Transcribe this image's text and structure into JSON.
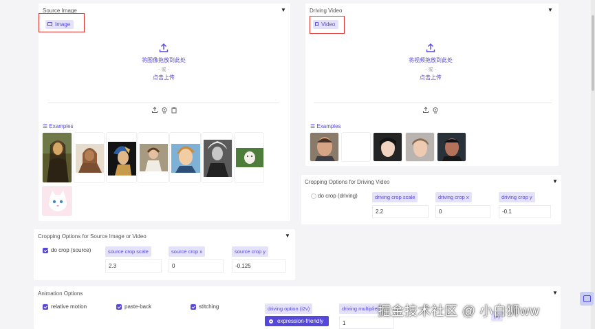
{
  "source_panel": {
    "title": "Source Image",
    "tab_label": "Image",
    "drop_text": "将图像拖放到此处",
    "or_text": "- 或 -",
    "click_upload": "点击上传",
    "examples_label": "Examples"
  },
  "driving_panel": {
    "title": "Driving Video",
    "tab_label": "Video",
    "drop_text": "将视频拖放到此处",
    "or_text": "- 或 -",
    "click_upload": "点击上传",
    "examples_label": "Examples"
  },
  "driving_crop": {
    "title": "Cropping Options for Driving Video",
    "checkbox_label": "do crop (driving)",
    "checked": false,
    "scale_label": "driving crop scale",
    "scale_value": "2.2",
    "x_label": "driving crop x",
    "x_value": "0",
    "y_label": "driving crop y",
    "y_value": "-0.1"
  },
  "source_crop": {
    "title": "Cropping Options for Source Image or Video",
    "checkbox_label": "do crop (source)",
    "checked": true,
    "scale_label": "source crop scale",
    "scale_value": "2.3",
    "x_label": "source crop x",
    "x_value": "0",
    "y_label": "source crop y",
    "y_value": "-0.125"
  },
  "animation": {
    "title": "Animation Options",
    "relative_motion": "relative motion",
    "paste_back": "paste-back",
    "stitching": "stitching",
    "driving_option_label": "driving option (i2v)",
    "driving_option_value": "expression-friendly",
    "driving_multiplier_label": "driving multiplier",
    "driving_multiplier_value": "1",
    "extra_label_fragment": "(v)"
  },
  "watermark": "掘金技术社区 @ 小白狮ww",
  "colors": {
    "accent": "#5548d9",
    "tag_bg": "#e4e2fb",
    "highlight_red": "#e0302e"
  },
  "icons": {
    "upload": "upload-icon",
    "image_tab": "image-icon",
    "video_tab": "video-icon",
    "clipboard": "clipboard-icon",
    "webcam": "webcam-icon",
    "collapse": "triangle-down-icon"
  }
}
